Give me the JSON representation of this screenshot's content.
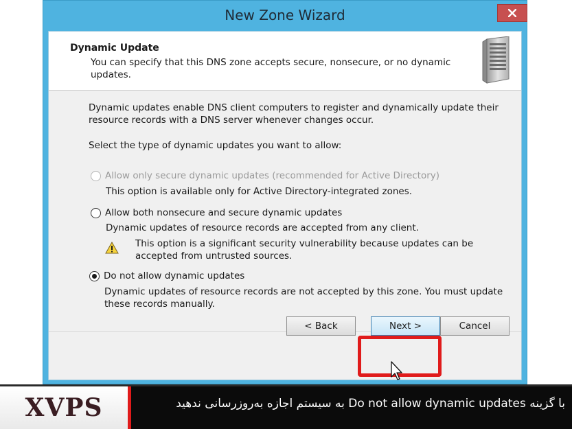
{
  "window": {
    "title": "New Zone Wizard",
    "close_label": "×"
  },
  "header": {
    "title": "Dynamic Update",
    "description": "You can specify that this DNS zone accepts secure, nonsecure, or no dynamic updates."
  },
  "body": {
    "intro": "Dynamic updates enable DNS client computers to register and dynamically update their resource records with a DNS server whenever changes occur.",
    "select_label": "Select the type of dynamic updates you want to allow:",
    "options": [
      {
        "label": "Allow only secure dynamic updates (recommended for Active Directory)",
        "description": "This option is available only for Active Directory-integrated zones.",
        "enabled": false,
        "selected": false
      },
      {
        "label": "Allow both nonsecure and secure dynamic updates",
        "description": "Dynamic updates of resource records are accepted from any client.",
        "warning": "This option is a significant security vulnerability because updates can be accepted from untrusted sources.",
        "enabled": true,
        "selected": false
      },
      {
        "label": "Do not allow dynamic updates",
        "description": "Dynamic updates of resource records are not accepted by this zone. You must update these records manually.",
        "enabled": true,
        "selected": true
      }
    ]
  },
  "buttons": {
    "back": "< Back",
    "next": "Next >",
    "cancel": "Cancel"
  },
  "banner": {
    "logo": "XVPS",
    "caption": "با گزینه Do not allow dynamic updates به سیستم اجازه به‌روزرسانی ندهید"
  },
  "colors": {
    "titlebar": "#4fb3e0",
    "highlight": "#e01b1b",
    "close_button": "#c75050"
  }
}
